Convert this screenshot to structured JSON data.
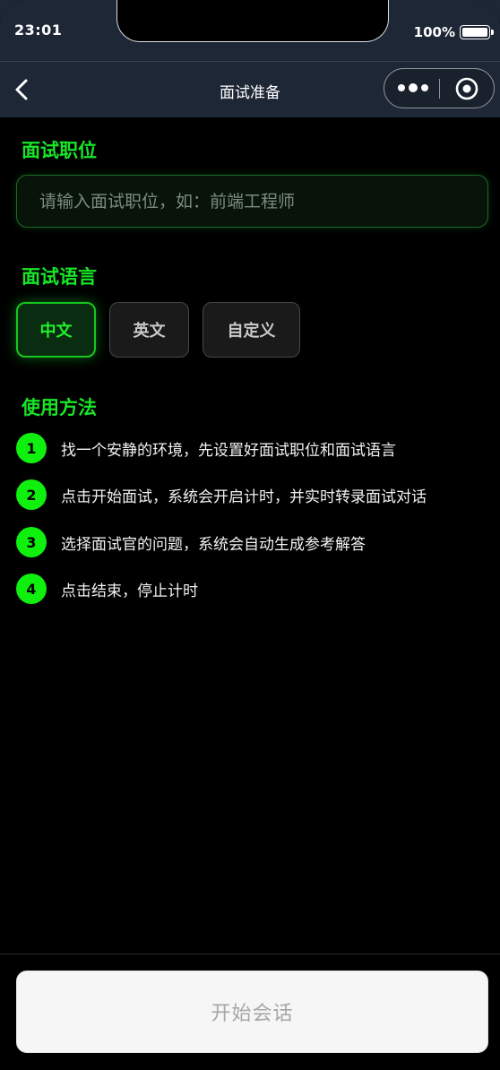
{
  "status_bar": {
    "time": "23:01",
    "battery": "100%"
  },
  "nav": {
    "title": "面试准备"
  },
  "position": {
    "title": "面试职位",
    "placeholder": "请输入面试职位，如：前端工程师",
    "value": ""
  },
  "language": {
    "title": "面试语言",
    "options": [
      {
        "label": "中文",
        "selected": true
      },
      {
        "label": "英文",
        "selected": false
      },
      {
        "label": "自定义",
        "selected": false
      }
    ]
  },
  "usage": {
    "title": "使用方法",
    "steps": [
      {
        "num": "1",
        "text": "找一个安静的环境，先设置好面试职位和面试语言"
      },
      {
        "num": "2",
        "text": "点击开始面试，系统会开启计时，并实时转录面试对话"
      },
      {
        "num": "3",
        "text": "选择面试官的问题，系统会自动生成参考解答"
      },
      {
        "num": "4",
        "text": "点击结束，停止计时"
      }
    ]
  },
  "footer": {
    "start_label": "开始会话"
  },
  "colors": {
    "accent": "#18e627",
    "background": "#000000",
    "navbar": "#1e2736"
  },
  "icons": [
    "back-arrow-icon",
    "more-dots-icon",
    "target-circle-icon"
  ]
}
